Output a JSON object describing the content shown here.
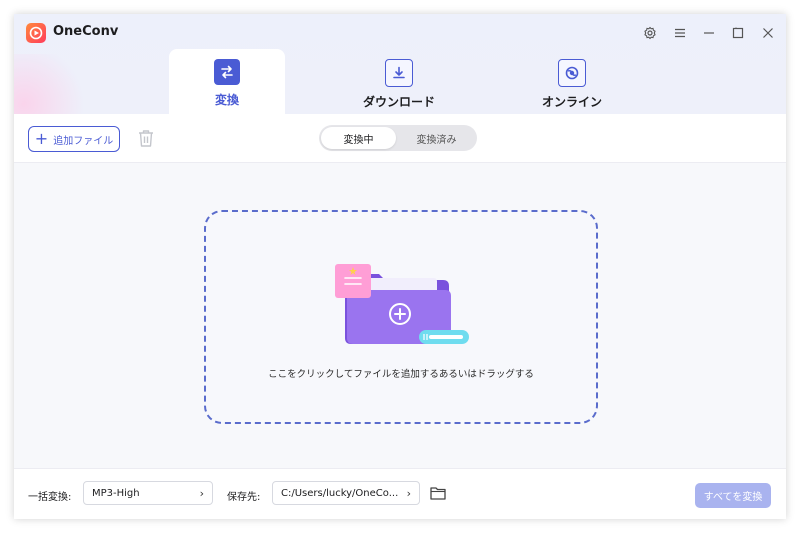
{
  "app": {
    "title": "OneConv"
  },
  "tabs": [
    {
      "label": "変換",
      "icon": "convert-icon",
      "active": true
    },
    {
      "label": "ダウンロード",
      "icon": "download-icon",
      "active": false
    },
    {
      "label": "オンライン",
      "icon": "online-icon",
      "active": false
    }
  ],
  "toolbar": {
    "add_file_label": "追加ファイル"
  },
  "segments": {
    "converting": "変換中",
    "converted": "変換済み"
  },
  "dropzone": {
    "text": "ここをクリックしてファイルを追加するあるいはドラッグする"
  },
  "footer": {
    "batch_label": "一括変換:",
    "batch_value": "MP3-High",
    "save_label": "保存先:",
    "save_path": "C:/Users/lucky/OneCo...",
    "convert_all_label": "すべてを変換"
  },
  "colors": {
    "accent": "#4a5bd4",
    "convert_all_bg": "#a9b3ef",
    "folder": "#8b63e6"
  }
}
